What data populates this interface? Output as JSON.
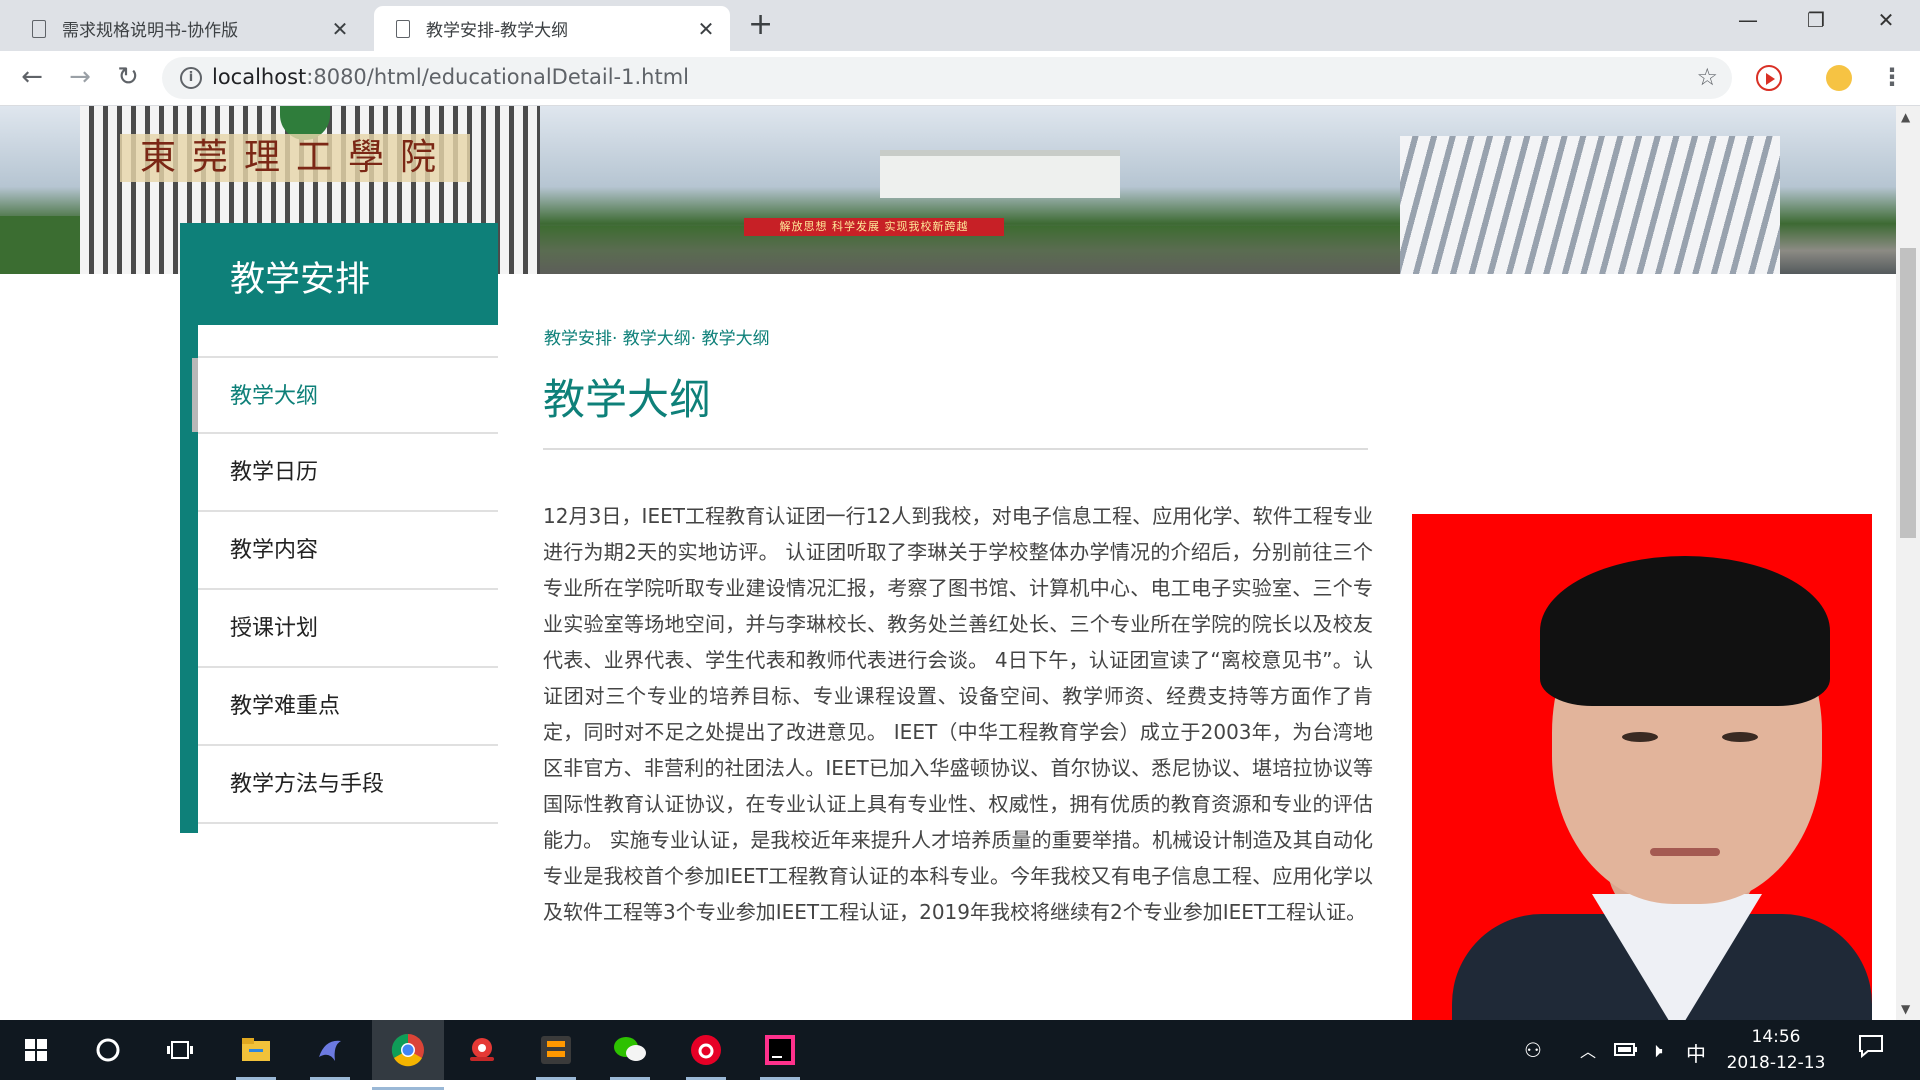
{
  "browser": {
    "tabs": [
      {
        "title": "需求规格说明书-协作版",
        "active": false
      },
      {
        "title": "教学安排-教学大纲",
        "active": true
      }
    ],
    "url_host": "localhost",
    "url_rest": ":8080/html/educationalDetail-1.html",
    "new_tab_icon": "+",
    "close_icon": "✕"
  },
  "banner": {
    "school_name": "東莞理工學院",
    "slogan": "解放思想  科学发展  实现我校新跨越"
  },
  "sidebar": {
    "heading": "教学安排",
    "items": [
      {
        "label": "教学大纲",
        "active": true
      },
      {
        "label": "教学日历",
        "active": false
      },
      {
        "label": "教学内容",
        "active": false
      },
      {
        "label": "授课计划",
        "active": false
      },
      {
        "label": "教学难重点",
        "active": false
      },
      {
        "label": "教学方法与手段",
        "active": false
      }
    ]
  },
  "main": {
    "breadcrumb": "教学安排· 教学大纲· 教学大纲",
    "title": "教学大纲",
    "article": "12月3日，IEET工程教育认证团一行12人到我校，对电子信息工程、应用化学、软件工程专业进行为期2天的实地访评。 认证团听取了李琳关于学校整体办学情况的介绍后，分别前往三个专业所在学院听取专业建设情况汇报，考察了图书馆、计算机中心、电工电子实验室、三个专业实验室等场地空间，并与李琳校长、教务处兰善红处长、三个专业所在学院的院长以及校友代表、业界代表、学生代表和教师代表进行会谈。 4日下午，认证团宣读了“离校意见书”。认证团对三个专业的培养目标、专业课程设置、设备空间、教学师资、经费支持等方面作了肯定，同时对不足之处提出了改进意见。 IEET（中华工程教育学会）成立于2003年，为台湾地区非官方、非营利的社团法人。IEET已加入华盛顿协议、首尔协议、悉尼协议、堪培拉协议等国际性教育认证协议，在专业认证上具有专业性、权威性，拥有优质的教育资源和专业的评估能力。 实施专业认证，是我校近年来提升人才培养质量的重要举措。机械设计制造及其自动化专业是我校首个参加IEET工程教育认证的本科专业。今年我校又有电子信息工程、应用化学以及软件工程等3个专业参加IEET工程认证，2019年我校将继续有2个专业参加IEET工程认证。"
  },
  "taskbar": {
    "ime": "中",
    "time": "14:56",
    "date": "2018-12-13"
  },
  "colors": {
    "accent": "#0e8079",
    "portrait_bg": "#ff0000"
  }
}
